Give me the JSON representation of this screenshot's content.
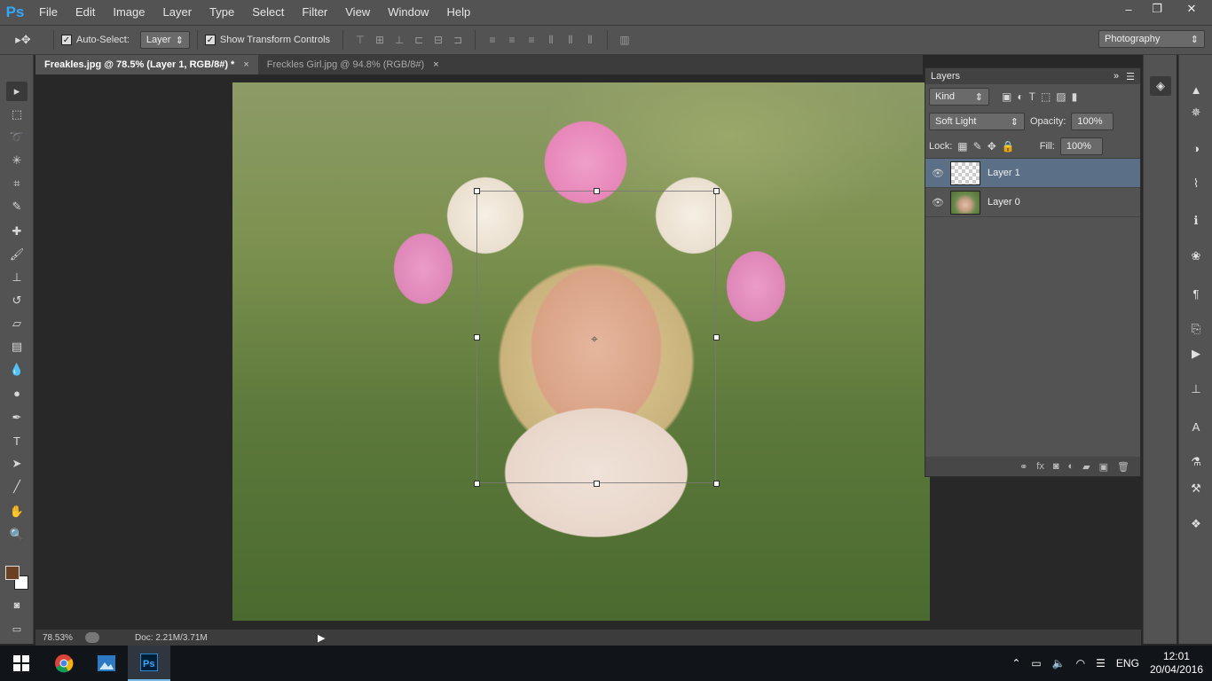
{
  "app": {
    "logo": "Ps"
  },
  "menu": [
    "File",
    "Edit",
    "Image",
    "Layer",
    "Type",
    "Select",
    "Filter",
    "View",
    "Window",
    "Help"
  ],
  "window_controls": {
    "minimize": "–",
    "restore": "❐",
    "close": "✕"
  },
  "options": {
    "auto_select_label": "Auto-Select:",
    "auto_select_value": "Layer",
    "transform_label": "Show Transform Controls",
    "workspace": "Photography"
  },
  "tabs": [
    {
      "label": "Freakles.jpg @ 78.5% (Layer 1, RGB/8#) *",
      "close": "×"
    },
    {
      "label": "Freckles Girl.jpg @ 94.8% (RGB/8#)",
      "close": "×"
    }
  ],
  "status": {
    "zoom": "78.53%",
    "doc": "Doc: 2.21M/3.71M"
  },
  "layers_panel": {
    "title": "Layers",
    "filter_kind": "Kind",
    "blend_mode": "Soft Light",
    "opacity_label": "Opacity:",
    "opacity_value": "100%",
    "lock_label": "Lock:",
    "fill_label": "Fill:",
    "fill_value": "100%",
    "layers": [
      {
        "name": "Layer 1",
        "selected": true
      },
      {
        "name": "Layer 0",
        "selected": false
      }
    ]
  },
  "taskbar": {
    "lang": "ENG",
    "time": "12:01",
    "date": "20/04/2016"
  },
  "colors": {
    "foreground": "#6b3f22",
    "background": "#ffffff",
    "accent": "#31a8ff"
  }
}
